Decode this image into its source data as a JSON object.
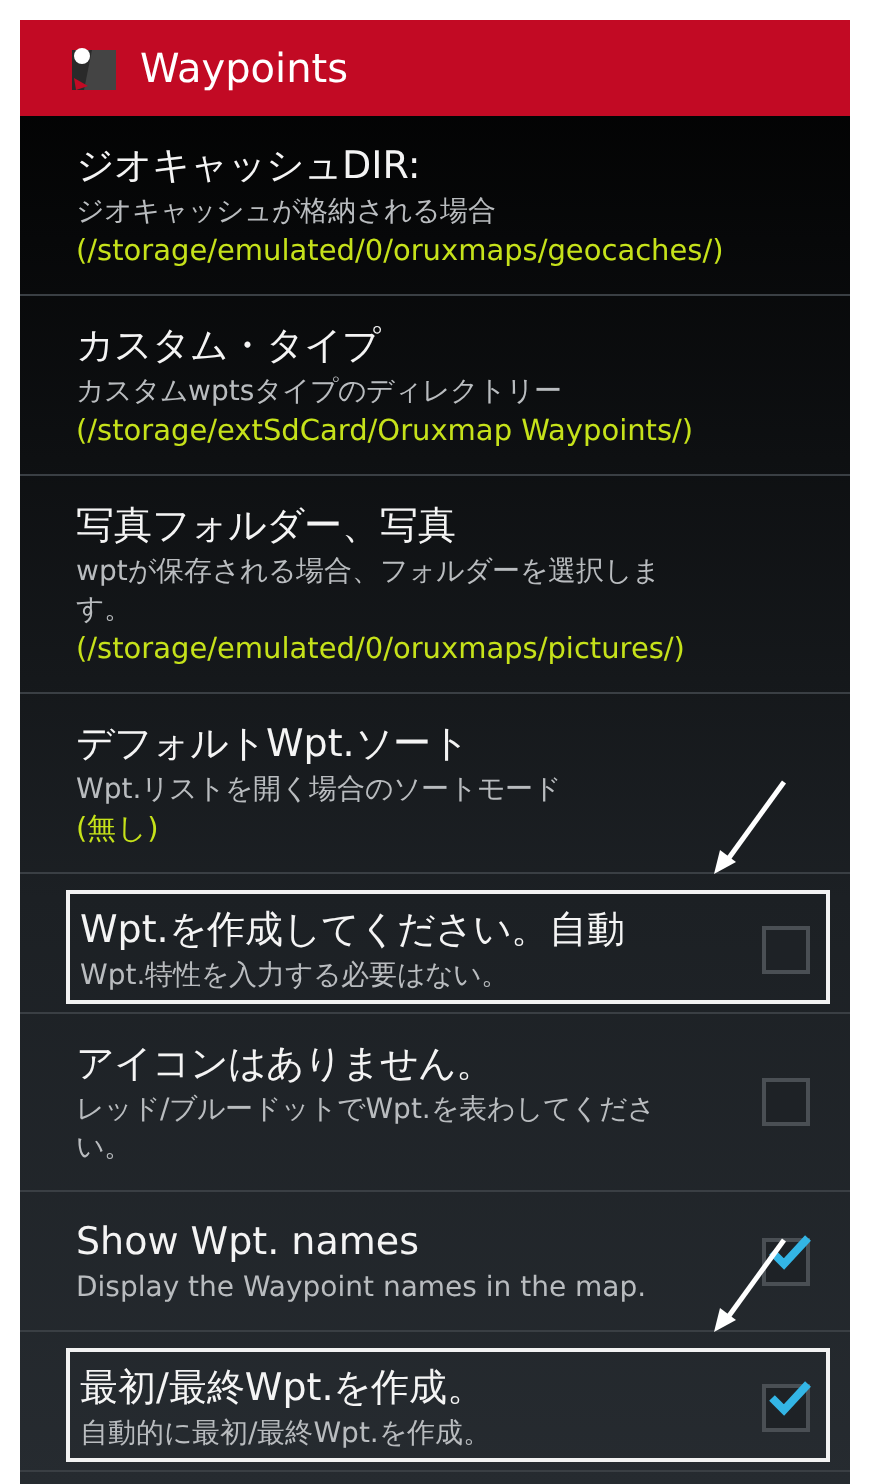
{
  "app_bar": {
    "title": "Waypoints"
  },
  "preferences": [
    {
      "kind": "path",
      "title": "ジオキャッシュDIR:",
      "summary": "ジオキャッシュが格納される場合",
      "value": "(/storage/emulated/0/oruxmaps/geocaches/)",
      "highlighted": false
    },
    {
      "kind": "path",
      "title": "カスタム・タイプ",
      "summary": "カスタムwptsタイプのディレクトリー",
      "value": "(/storage/extSdCard/Oruxmap Waypoints/)",
      "highlighted": false
    },
    {
      "kind": "path",
      "title": "写真フォルダー、写真",
      "summary": "wptが保存される場合、フォルダーを選択します。",
      "value": "(/storage/emulated/0/oruxmaps/pictures/)",
      "highlighted": false
    },
    {
      "kind": "path",
      "title": "デフォルトWpt.ソート",
      "summary": "Wpt.リストを開く場合のソートモード",
      "value": "(無し)",
      "highlighted": false
    },
    {
      "kind": "checkbox",
      "title": "Wpt.を作成してください。自動",
      "summary": "Wpt.特性を入力する必要はない。",
      "checked": false,
      "highlighted": true
    },
    {
      "kind": "checkbox",
      "title": "アイコンはありません。",
      "summary": "レッド/ブルードットでWpt.を表わしてください。",
      "checked": false,
      "highlighted": false
    },
    {
      "kind": "checkbox",
      "title": "Show Wpt. names",
      "summary": "Display the Waypoint names in the map.",
      "checked": true,
      "highlighted": false
    },
    {
      "kind": "checkbox",
      "title": "最初/最終Wpt.を作成。",
      "summary": "自動的に最初/最終Wpt.を作成。",
      "checked": true,
      "highlighted": true
    }
  ]
}
